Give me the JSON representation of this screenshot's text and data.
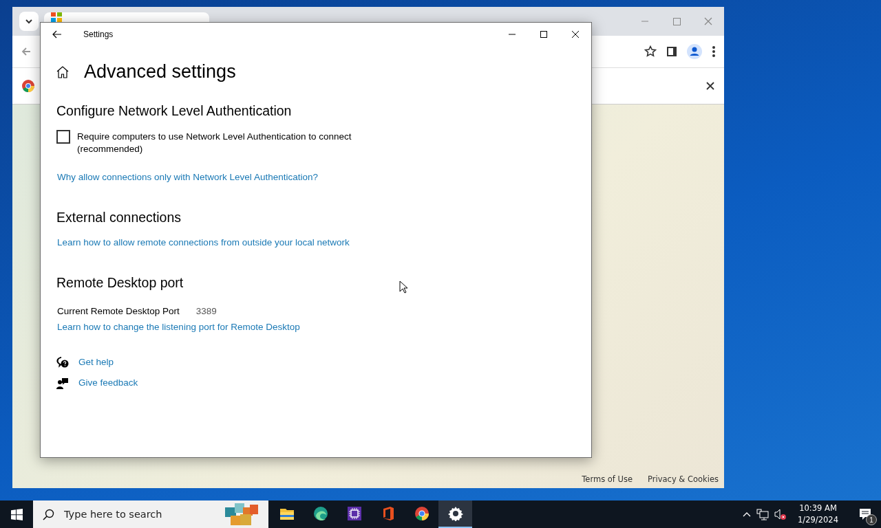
{
  "browser": {
    "footer_links": [
      "Terms of Use",
      "Privacy & Cookies"
    ]
  },
  "settings": {
    "title": "Settings",
    "heading": "Advanced settings",
    "sections": [
      {
        "title": "Configure Network Level Authentication",
        "items": [
          {
            "kind": "checkbox",
            "label": "Require computers to use Network Level Authentication to connect (recommended)",
            "checked": false
          },
          {
            "kind": "link",
            "label": "Why allow connections only with Network Level Authentication?"
          }
        ]
      },
      {
        "title": "External connections",
        "items": [
          {
            "kind": "link",
            "label": "Learn how to allow remote connections from outside your local network"
          }
        ]
      },
      {
        "title": "Remote Desktop port",
        "items": [
          {
            "kind": "field",
            "label": "Current Remote Desktop Port",
            "value": "3389"
          },
          {
            "kind": "link",
            "label": "Learn how to change the listening port for Remote Desktop"
          }
        ]
      }
    ],
    "help_links": [
      {
        "kind": "help",
        "label": "Get help"
      },
      {
        "kind": "feedback",
        "label": "Give feedback"
      }
    ]
  },
  "taskbar": {
    "search": {
      "placeholder": "Type here to search"
    },
    "apps": [
      {
        "kind": "files",
        "selected": false
      },
      {
        "kind": "edge",
        "selected": false
      },
      {
        "kind": "chip",
        "selected": false
      },
      {
        "kind": "office",
        "selected": false
      },
      {
        "kind": "chrome",
        "selected": false
      },
      {
        "kind": "settings",
        "selected": true
      }
    ],
    "time": "10:39 AM",
    "date": "1/29/2024",
    "notifications": "1"
  }
}
